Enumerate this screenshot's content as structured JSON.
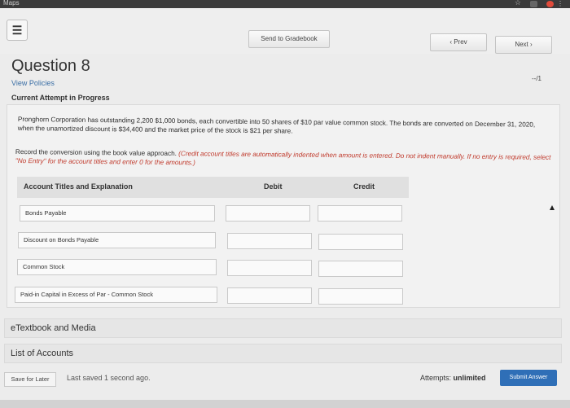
{
  "browser": {
    "maps_label": "Maps",
    "star_icon": "star-icon",
    "extension_icon": "extension-icon",
    "notification_badge_color": "#e04a3a",
    "menu_dots_icon": "more-vert-icon"
  },
  "header": {
    "menu_icon": "hamburger-icon",
    "send_to_gradebook": "Send to Gradebook",
    "prev": "‹ Prev",
    "next": "Next ›"
  },
  "question": {
    "title": "Question 8",
    "score": "--/1",
    "view_policies": "View Policies",
    "attempt_status": "Current Attempt in Progress",
    "problem_text": "Pronghorn Corporation has outstanding 2,200 $1,000 bonds, each convertible into 50 shares of $10 par value common stock. The bonds are converted on December 31, 2020, when the unamortized discount is $34,400 and the market price of the stock is $21 per share.",
    "instruction_plain": "Record the conversion using the book value approach. ",
    "instruction_red": "(Credit account titles are automatically indented when amount is entered. Do not indent manually. If no entry is required, select \"No Entry\" for the account titles and enter 0 for the amounts.)"
  },
  "table": {
    "headers": {
      "account": "Account Titles and Explanation",
      "debit": "Debit",
      "credit": "Credit"
    },
    "rows": [
      {
        "account": "Bonds Payable",
        "debit": "",
        "credit": ""
      },
      {
        "account": "Discount on Bonds Payable",
        "debit": "",
        "credit": ""
      },
      {
        "account": "Common Stock",
        "debit": "",
        "credit": ""
      },
      {
        "account": "Paid-in Capital in Excess of Par - Common Stock",
        "debit": "",
        "credit": ""
      }
    ]
  },
  "sections": {
    "etextbook": "eTextbook and Media",
    "list_of_accounts": "List of Accounts"
  },
  "footer": {
    "save_for_later": "Save for Later",
    "last_saved": "Last saved 1 second ago.",
    "attempts_label": "Attempts:",
    "attempts_value": "unlimited",
    "submit": "Submit Answer"
  },
  "colors": {
    "accent_blue": "#2f6fb7",
    "link_blue": "#3a6ea5",
    "instruction_red": "#c0392b"
  }
}
